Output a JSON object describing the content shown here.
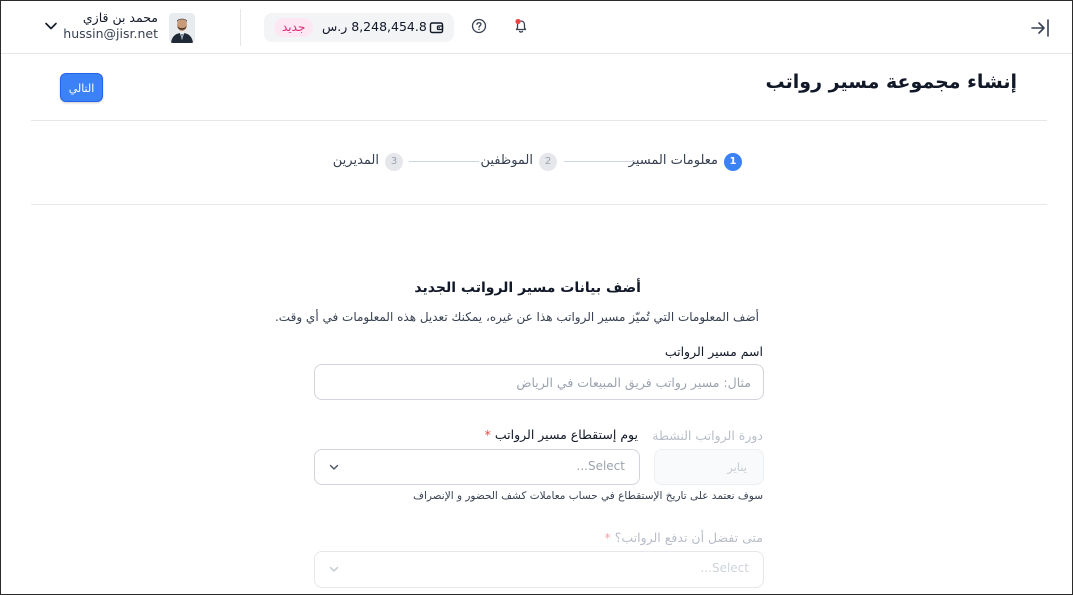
{
  "topbar": {
    "user": {
      "name": "محمد بن قازي",
      "email": "hussin@jisr.net"
    },
    "balance": {
      "amount": "8,248,454.8 ر.س",
      "badge": "جديد"
    },
    "icons": {
      "collapse": "collapse-sidebar-icon",
      "bell": "bell-icon",
      "help": "help-icon",
      "wallet": "wallet-icon",
      "chevron": "chevron-down-icon"
    }
  },
  "header": {
    "title": "إنشاء مجموعة مسير رواتب",
    "next_label": "التالي"
  },
  "stepper": {
    "steps": [
      {
        "number": "1",
        "label": "معلومات المسير",
        "state": "active"
      },
      {
        "number": "2",
        "label": "الموظفين",
        "state": "inactive"
      },
      {
        "number": "3",
        "label": "المديرين",
        "state": "inactive"
      }
    ]
  },
  "form": {
    "title": "أضف بيانات مسير الرواتب الجديد",
    "description": "أضف المعلومات التي تُميّز مسير الرواتب هذا عن غيره، يمكنك تعديل هذه المعلومات في أي وقت.",
    "payroll_name": {
      "label": "اسم مسير الرواتب",
      "placeholder": "مثال: مسير رواتب فريق المبيعات في الرياض"
    },
    "active_cycle": {
      "label": "دورة الرواتب النشطة",
      "value": "يناير"
    },
    "cutoff_day": {
      "label": "يوم إستقطاع مسير الرواتب",
      "required_mark": "*",
      "placeholder": "Select...",
      "helper": "سوف نعتمد على تاريخ الإستقطاع في حساب معاملات كشف الحضور و الإنصراف"
    },
    "pay_date": {
      "label": "متى تفضل أن تدفع الرواتب؟",
      "required_mark": "*",
      "placeholder": "Select..."
    }
  },
  "colors": {
    "primary": "#3b82f6",
    "badge_bg": "#fde7f3",
    "badge_text": "#db2777",
    "required": "#ef4444"
  }
}
